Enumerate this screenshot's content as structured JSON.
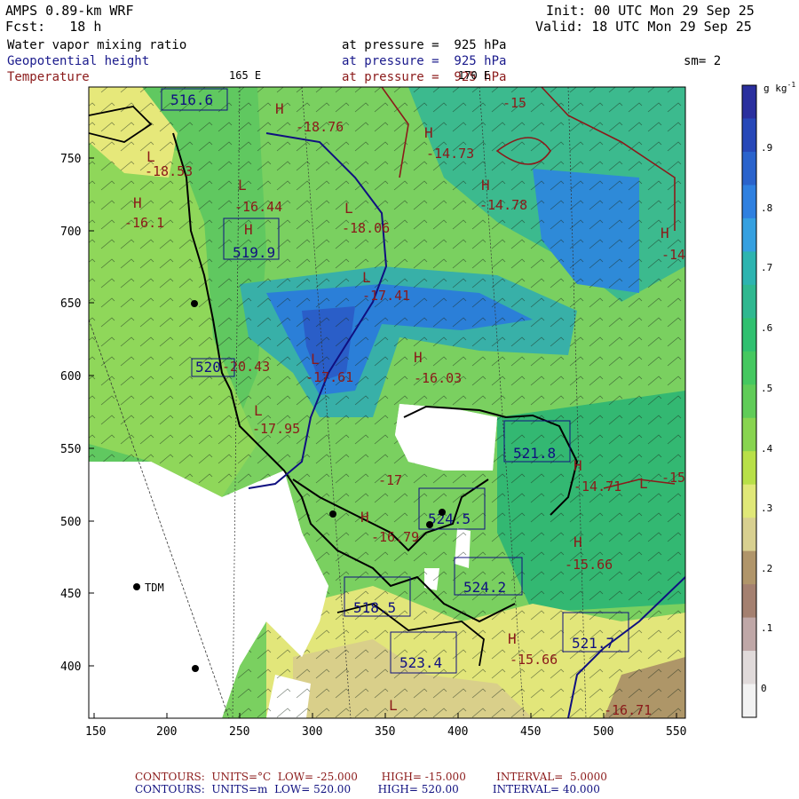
{
  "header": {
    "model": "AMPS 0.89-km WRF",
    "forecast_label": "Fcst:",
    "forecast_value": "18 h",
    "init": "Init: 00 UTC Mon 29 Sep 25",
    "valid": "Valid: 18 UTC Mon 29 Sep 25"
  },
  "fields": [
    {
      "name": "Water vapor mixing ratio",
      "level": "at pressure =  925 hPa",
      "color": "#000000"
    },
    {
      "name": "Geopotential height",
      "level": "at pressure =  925 hPa",
      "color": "#1a1a8c"
    },
    {
      "name": "Temperature",
      "level": "at pressure =  925 hPa",
      "color": "#8b1a1a"
    }
  ],
  "smoothing": "sm= 2",
  "meridian_labels": [
    "165 E",
    "170 E"
  ],
  "axes": {
    "x_ticks": [
      "150",
      "200",
      "250",
      "300",
      "350",
      "400",
      "450",
      "500",
      "550"
    ],
    "y_ticks": [
      "750",
      "700",
      "650",
      "600",
      "550",
      "500",
      "450",
      "400"
    ]
  },
  "colorbar": {
    "unit": "g kg",
    "unit_exp": "-1",
    "labels": [
      ".9",
      ".8",
      ".7",
      ".6",
      ".5",
      ".4",
      ".3",
      ".2",
      ".1",
      "0"
    ],
    "colors": [
      "#2a2f9e",
      "#2748b8",
      "#2a63cc",
      "#2f80e0",
      "#35a0e0",
      "#2db4b0",
      "#2fb890",
      "#30c070",
      "#45c860",
      "#60cc58",
      "#88d450",
      "#b8e048",
      "#e0e878",
      "#d8d090",
      "#b0956a",
      "#a48070",
      "#bfa7a7",
      "#e0dada",
      "#f2f2f2"
    ]
  },
  "station": "TDM",
  "map_labels": {
    "temps": [
      "-18.76",
      "-15",
      "-14.73",
      "-18.53",
      "-16.44",
      "-14.78",
      "-16.1",
      "-18.06",
      "-17.41",
      "-14",
      "-20.43",
      "-16.03",
      "-17.61",
      "-17.95",
      "-17",
      "-14.71",
      "-15",
      "-16.79",
      "-15.66",
      "-15.66",
      "-16.71"
    ],
    "heights": [
      "516.6",
      "519.9",
      "520",
      "521.8",
      "524.5",
      "524.2",
      "518.5",
      "523.4",
      "521.7"
    ],
    "highs": [
      "H",
      "H",
      "H",
      "H",
      "H",
      "H",
      "H",
      "H",
      "H",
      "H",
      "H"
    ],
    "lows": [
      "L",
      "L",
      "L",
      "L",
      "L",
      "L",
      "L",
      "L"
    ]
  },
  "footer": {
    "line1": {
      "contours": "CONTOURS:",
      "units": "UNITS=°C",
      "low": "LOW= -25.000",
      "high": "HIGH= -15.000",
      "interval": "INTERVAL=  5.0000"
    },
    "line2": {
      "contours": "CONTOURS:",
      "units": "UNITS=m",
      "low": "LOW= 520.00",
      "high": "HIGH= 520.00",
      "interval": "INTERVAL= 40.000"
    }
  }
}
